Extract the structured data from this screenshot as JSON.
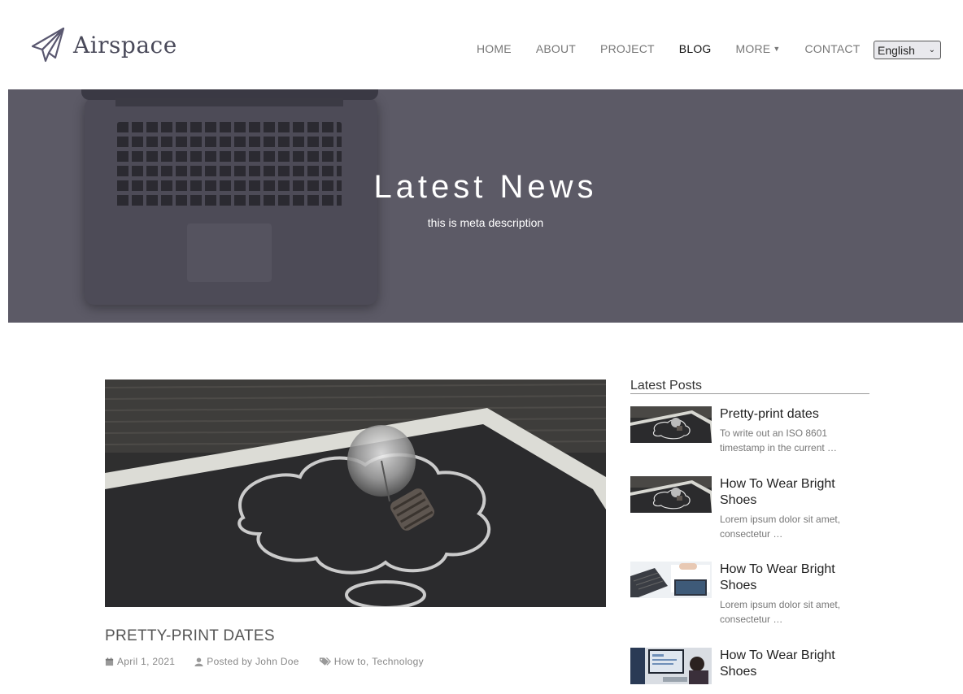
{
  "brand": {
    "name": "Airspace"
  },
  "nav": {
    "items": [
      {
        "label": "HOME"
      },
      {
        "label": "ABOUT"
      },
      {
        "label": "PROJECT"
      },
      {
        "label": "BLOG",
        "active": true
      },
      {
        "label": "MORE",
        "has_dropdown": true
      },
      {
        "label": "CONTACT"
      }
    ],
    "language": "English"
  },
  "hero": {
    "title": "Latest News",
    "meta_description": "this is meta description"
  },
  "post": {
    "title": "PRETTY-PRINT DATES",
    "date": "April 1, 2021",
    "author": "Posted by John Doe",
    "tags": [
      "How to",
      "Technology"
    ],
    "tag_separator": ", "
  },
  "sidebar": {
    "title": "Latest Posts",
    "posts": [
      {
        "title": "Pretty-print dates",
        "excerpt_line1": "To write out an ISO 8601",
        "excerpt_line2": "timestamp in the current …"
      },
      {
        "title": "How To Wear Bright Shoes",
        "excerpt_line1": "Lorem ipsum dolor sit amet,",
        "excerpt_line2": "consectetur …"
      },
      {
        "title": "How To Wear Bright Shoes",
        "excerpt_line1": "Lorem ipsum dolor sit amet,",
        "excerpt_line2": "consectetur …"
      },
      {
        "title": "How To Wear Bright Shoes"
      }
    ]
  },
  "colors": {
    "hero_overlay": "#5c5a66",
    "nav_active": "#111111",
    "nav_default": "#777777"
  }
}
